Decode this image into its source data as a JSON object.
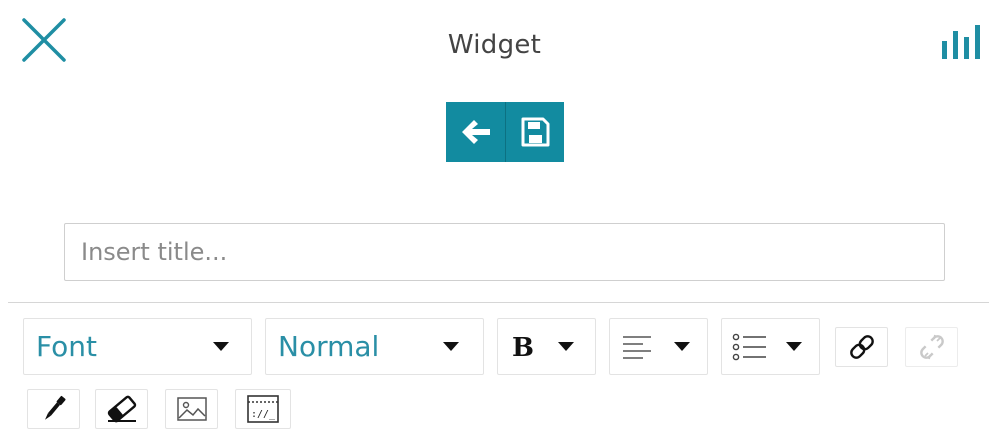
{
  "header": {
    "title": "Widget",
    "close_icon": "close-icon",
    "stats_icon": "bar-chart-icon"
  },
  "actions": {
    "back_icon": "arrow-left-icon",
    "save_icon": "floppy-disk-icon",
    "accent_color": "#128ba0"
  },
  "title_field": {
    "value": "",
    "placeholder": "Insert title..."
  },
  "toolbar": {
    "font_select": {
      "value": "Font"
    },
    "size_select": {
      "value": "Normal"
    },
    "icons": [
      "bold-icon",
      "align-left-icon",
      "list-icon",
      "link-icon",
      "unlink-icon",
      "pen-icon",
      "eraser-icon",
      "image-icon",
      "code-icon"
    ]
  }
}
